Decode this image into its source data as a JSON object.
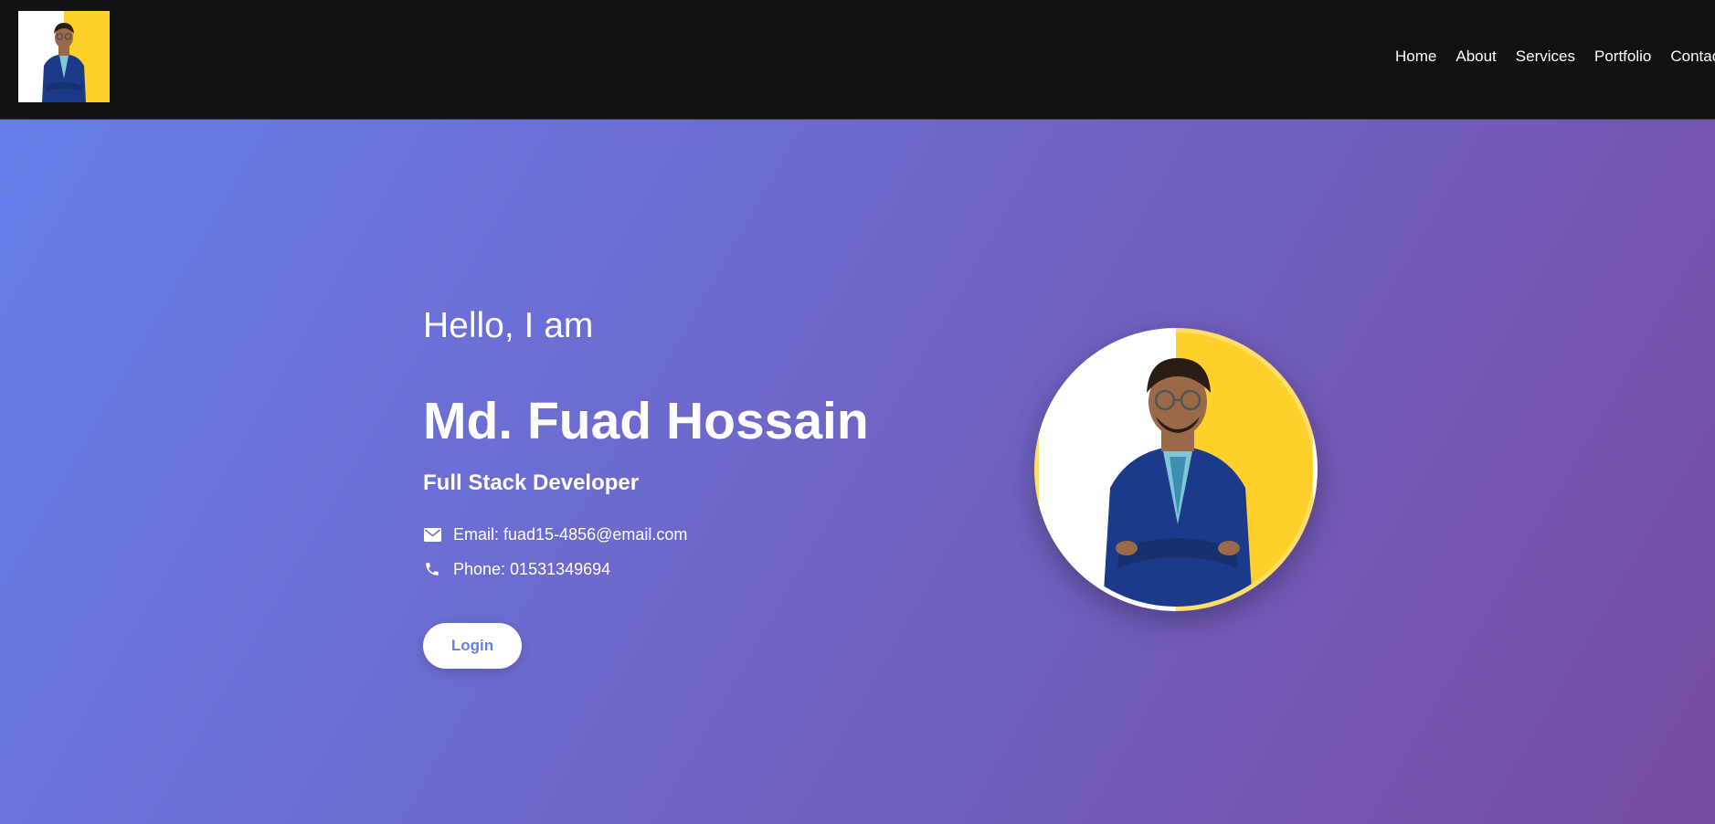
{
  "nav": {
    "logo_icon": "profile-portrait",
    "links": [
      "Home",
      "About",
      "Services",
      "Portfolio",
      "Contac"
    ]
  },
  "hero": {
    "greeting": "Hello, I am",
    "name": "Md. Fuad Hossain",
    "role": "Full Stack Developer",
    "email": "Email: fuad15-4856@email.com",
    "phone": "Phone: 01531349694",
    "login_label": "Login",
    "photo_icon": "profile-portrait"
  },
  "colors": {
    "navbar": "#111111",
    "gradient_start": "#667eea",
    "gradient_end": "#764ba2",
    "accent_yellow": "#ffcf2a",
    "button_text": "#667eea"
  }
}
